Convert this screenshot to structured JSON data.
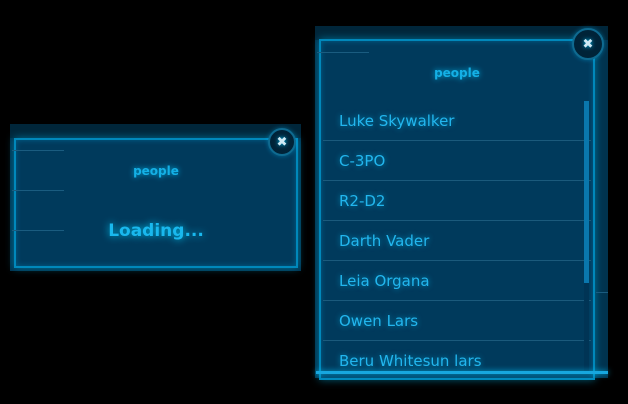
{
  "left_panel": {
    "title": "people",
    "loading_text": "Loading...",
    "close_icon": "✖"
  },
  "right_panel": {
    "title": "people",
    "close_icon": "✖",
    "items": [
      {
        "label": "Luke Skywalker"
      },
      {
        "label": "C-3PO"
      },
      {
        "label": "R2-D2"
      },
      {
        "label": "Darth Vader"
      },
      {
        "label": "Leia Organa"
      },
      {
        "label": "Owen Lars"
      },
      {
        "label": "Beru Whitesun lars"
      }
    ]
  },
  "colors": {
    "background": "#000000",
    "panel": "#003a5c",
    "accent": "#19b8ee",
    "border": "#0088bb"
  }
}
